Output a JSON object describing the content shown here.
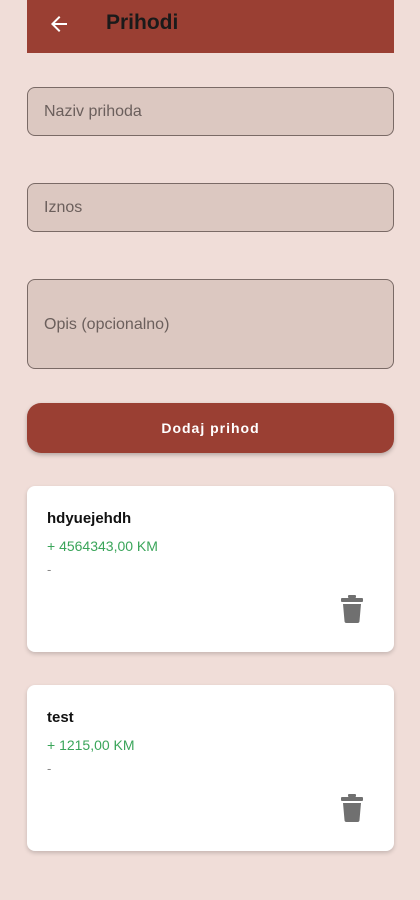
{
  "appbar": {
    "title": "Prihodi",
    "back_icon": "arrow-left-icon",
    "background_color": "#9a3f33"
  },
  "form": {
    "name_placeholder": "Naziv prihoda",
    "amount_placeholder": "Iznos",
    "description_placeholder": "Opis (opcionalno)",
    "submit_label": "Dodaj prihod"
  },
  "incomes": [
    {
      "name": "hdyuejehdh",
      "amount": "+ 4564343,00 KM",
      "description": "-",
      "delete_icon": "trash-icon"
    },
    {
      "name": "test",
      "amount": "+ 1215,00 KM",
      "description": "-",
      "delete_icon": "trash-icon"
    }
  ],
  "colors": {
    "accent": "#9a3f33",
    "background": "#f0ddd8",
    "amount_positive": "#3aa55a"
  }
}
